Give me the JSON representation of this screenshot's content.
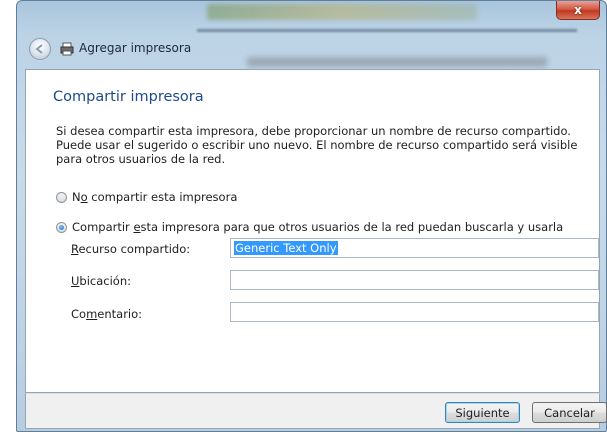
{
  "window": {
    "title": "Agregar impresora",
    "close_glyph": "x",
    "colors": {
      "accent_heading": "#1e4a8a",
      "selection": "#3399ff",
      "close": "#c0391f"
    }
  },
  "page": {
    "heading": "Compartir impresora",
    "description": "Si desea compartir esta impresora, debe proporcionar un nombre de recurso compartido. Puede usar el sugerido o escribir uno nuevo. El nombre de recurso compartido será visible para otros usuarios de la red."
  },
  "options": {
    "no_share": {
      "label_pre": "N",
      "label_accel": "o",
      "label_post": " compartir esta impresora",
      "checked": false
    },
    "share": {
      "label_pre": "Compartir ",
      "label_accel": "e",
      "label_post": "sta impresora para que otros usuarios de la red puedan buscarla y usarla",
      "checked": true
    }
  },
  "fields": {
    "share_name": {
      "label_pre": "",
      "label_accel": "R",
      "label_post": "ecurso compartido:",
      "value": "Generic  Text Only"
    },
    "location": {
      "label_pre": "",
      "label_accel": "U",
      "label_post": "bicación:",
      "value": ""
    },
    "comment": {
      "label_pre": "Co",
      "label_accel": "m",
      "label_post": "entario:",
      "value": ""
    }
  },
  "buttons": {
    "next": "Siguiente",
    "cancel": "Cancelar"
  }
}
